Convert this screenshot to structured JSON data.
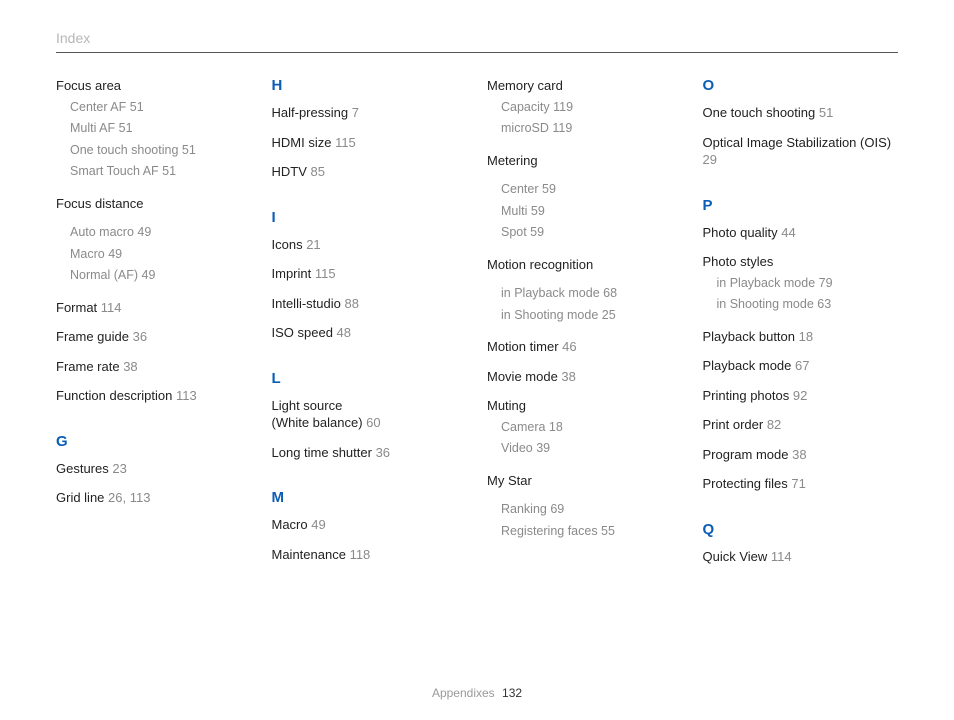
{
  "header_title": "Index",
  "footer": {
    "section": "Appendixes",
    "page": "132"
  },
  "column1": [
    {
      "kind": "entry",
      "text": "Focus area"
    },
    {
      "kind": "sub",
      "text": "Center AF  51"
    },
    {
      "kind": "sub",
      "text": "Multi AF  51"
    },
    {
      "kind": "sub",
      "text": "One touch shooting  51"
    },
    {
      "kind": "sub",
      "text": "Smart Touch AF  51"
    },
    {
      "kind": "entry",
      "text": "Focus distance"
    },
    {
      "kind": "sub",
      "text": "Auto macro  49"
    },
    {
      "kind": "sub",
      "text": "Macro  49"
    },
    {
      "kind": "sub",
      "text": "Normal (AF)  49"
    },
    {
      "kind": "entryp",
      "text": "Format",
      "pg": "114"
    },
    {
      "kind": "entryp",
      "text": "Frame guide",
      "pg": "36"
    },
    {
      "kind": "entryp",
      "text": "Frame rate",
      "pg": "38"
    },
    {
      "kind": "entryp",
      "text": "Function description",
      "pg": "113"
    },
    {
      "kind": "letter",
      "text": "G"
    },
    {
      "kind": "entryp",
      "text": "Gestures",
      "pg": "23"
    },
    {
      "kind": "entryp",
      "text": "Grid line",
      "pg": "26, 113"
    }
  ],
  "column2": [
    {
      "kind": "letter",
      "text": "H",
      "first": true
    },
    {
      "kind": "entryp",
      "text": "Half-pressing",
      "pg": "7"
    },
    {
      "kind": "entryp",
      "text": "HDMI size",
      "pg": "115"
    },
    {
      "kind": "entryp",
      "text": "HDTV",
      "pg": "85"
    },
    {
      "kind": "letter",
      "text": "I"
    },
    {
      "kind": "entryp",
      "text": "Icons",
      "pg": "21"
    },
    {
      "kind": "entryp",
      "text": "Imprint",
      "pg": "115"
    },
    {
      "kind": "entryp",
      "text": "Intelli-studio",
      "pg": "88"
    },
    {
      "kind": "entryp",
      "text": "ISO speed",
      "pg": "48"
    },
    {
      "kind": "letter",
      "text": "L"
    },
    {
      "kind": "entryp",
      "text": "Light source\n(White balance)",
      "pg": "60"
    },
    {
      "kind": "entryp",
      "text": "Long time shutter",
      "pg": "36"
    },
    {
      "kind": "letter",
      "text": "M"
    },
    {
      "kind": "entryp",
      "text": "Macro",
      "pg": "49"
    },
    {
      "kind": "entryp",
      "text": "Maintenance",
      "pg": "118"
    }
  ],
  "column3": [
    {
      "kind": "entry",
      "text": "Memory card"
    },
    {
      "kind": "sub",
      "text": "Capacity  119"
    },
    {
      "kind": "sub",
      "text": "microSD  119"
    },
    {
      "kind": "entry",
      "text": "Metering"
    },
    {
      "kind": "sub",
      "text": "Center  59"
    },
    {
      "kind": "sub",
      "text": "Multi  59"
    },
    {
      "kind": "sub",
      "text": "Spot  59"
    },
    {
      "kind": "entry",
      "text": "Motion recognition"
    },
    {
      "kind": "sub",
      "text": "in Playback mode  68"
    },
    {
      "kind": "sub",
      "text": "in Shooting mode  25"
    },
    {
      "kind": "entryp",
      "text": "Motion timer",
      "pg": "46"
    },
    {
      "kind": "entryp",
      "text": "Movie mode",
      "pg": "38"
    },
    {
      "kind": "entry",
      "text": "Muting"
    },
    {
      "kind": "sub",
      "text": "Camera  18"
    },
    {
      "kind": "sub",
      "text": "Video  39"
    },
    {
      "kind": "entry",
      "text": "My Star"
    },
    {
      "kind": "sub",
      "text": "Ranking  69"
    },
    {
      "kind": "sub",
      "text": "Registering faces  55"
    }
  ],
  "column4": [
    {
      "kind": "letter",
      "text": "O",
      "first": true
    },
    {
      "kind": "entryp",
      "text": "One touch shooting",
      "pg": "51"
    },
    {
      "kind": "entryp",
      "text": "Optical Image Stabilization (OIS)",
      "pg": "29"
    },
    {
      "kind": "letter",
      "text": "P"
    },
    {
      "kind": "entryp",
      "text": "Photo quality",
      "pg": "44"
    },
    {
      "kind": "entry",
      "text": "Photo styles"
    },
    {
      "kind": "sub",
      "text": "in Playback mode  79"
    },
    {
      "kind": "sub",
      "text": "in Shooting mode  63"
    },
    {
      "kind": "entryp",
      "text": "Playback button",
      "pg": "18"
    },
    {
      "kind": "entryp",
      "text": "Playback mode",
      "pg": "67"
    },
    {
      "kind": "entryp",
      "text": "Printing photos",
      "pg": "92"
    },
    {
      "kind": "entryp",
      "text": "Print order",
      "pg": "82"
    },
    {
      "kind": "entryp",
      "text": "Program mode",
      "pg": "38"
    },
    {
      "kind": "entryp",
      "text": "Protecting files",
      "pg": "71"
    },
    {
      "kind": "letter",
      "text": "Q"
    },
    {
      "kind": "entryp",
      "text": "Quick View",
      "pg": "114"
    }
  ]
}
